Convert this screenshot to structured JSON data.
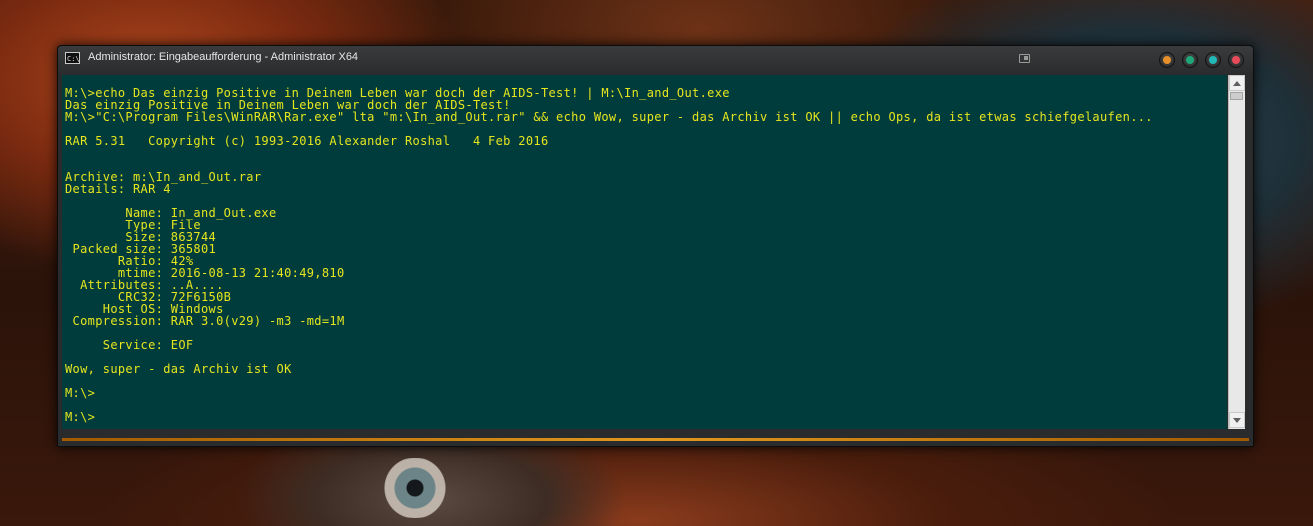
{
  "window": {
    "title": "Administrator: Eingabeaufforderung - Administrator X64",
    "app_icon_text": "C:\\",
    "icons": {
      "app": "command-prompt-icon",
      "pin": "window-pin-icon"
    },
    "buttons": [
      {
        "name": "minimize",
        "color": "#e8902a"
      },
      {
        "name": "maximize",
        "color": "#1ea87a"
      },
      {
        "name": "restore",
        "color": "#22b8b8"
      },
      {
        "name": "close",
        "color": "#e84a5a"
      }
    ]
  },
  "console": {
    "background": "#003c3c",
    "foreground": "#e6e61e",
    "lines": [
      "M:\\>echo Das einzig Positive in Deinem Leben war doch der AIDS-Test! | M:\\In_and_Out.exe",
      "Das einzig Positive in Deinem Leben war doch der AIDS-Test!",
      "M:\\>\"C:\\Program Files\\WinRAR\\Rar.exe\" lta \"m:\\In_and_Out.rar\" && echo Wow, super - das Archiv ist OK || echo Ops, da ist etwas schiefgelaufen...",
      "",
      "RAR 5.31   Copyright (c) 1993-2016 Alexander Roshal   4 Feb 2016",
      "",
      "",
      "Archive: m:\\In_and_Out.rar",
      "Details: RAR 4",
      "",
      "        Name: In_and_Out.exe",
      "        Type: File",
      "        Size: 863744",
      " Packed size: 365801",
      "       Ratio: 42%",
      "       mtime: 2016-08-13 21:40:49,810",
      "  Attributes: ..A....",
      "       CRC32: 72F6150B",
      "     Host OS: Windows",
      " Compression: RAR 3.0(v29) -m3 -md=1M",
      "",
      "     Service: EOF",
      "",
      "Wow, super - das Archiv ist OK",
      "",
      "M:\\>",
      "",
      "M:\\>"
    ]
  },
  "scrollbar": {
    "up_icon": "scroll-up-arrow-icon",
    "down_icon": "scroll-down-arrow-icon"
  }
}
